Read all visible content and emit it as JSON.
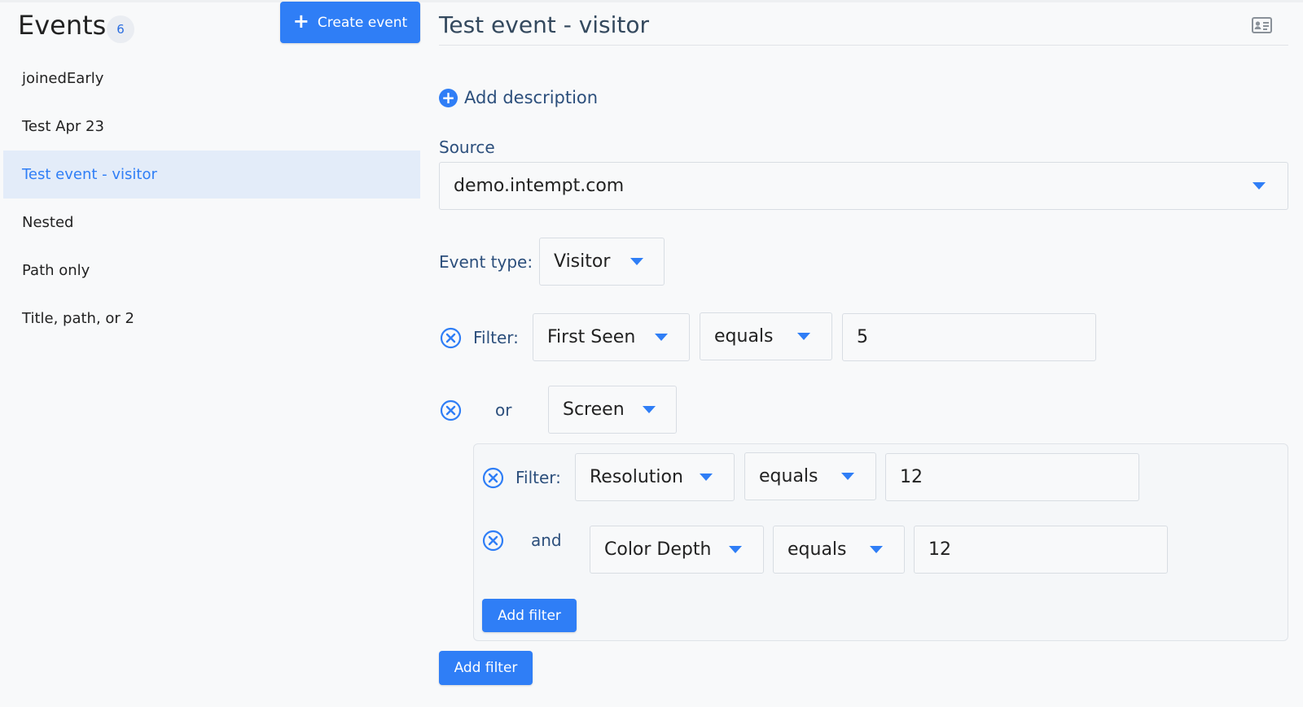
{
  "sidebar": {
    "title": "Events",
    "count": "6",
    "create_label": "Create event",
    "items": [
      {
        "label": "joinedEarly"
      },
      {
        "label": "Test Apr 23"
      },
      {
        "label": "Test event - visitor"
      },
      {
        "label": "Nested"
      },
      {
        "label": "Path only"
      },
      {
        "label": "Title, path, or 2"
      }
    ]
  },
  "main": {
    "title": "Test event - visitor",
    "add_description": "Add description",
    "source_label": "Source",
    "source_value": "demo.intempt.com",
    "event_type_label": "Event type:",
    "event_type_value": "Visitor",
    "filter1": {
      "label": "Filter:",
      "field": "First Seen",
      "op": "equals",
      "value": "5"
    },
    "or_group": {
      "connector": "or",
      "field": "Screen",
      "filter": {
        "label": "Filter:",
        "field": "Resolution",
        "op": "equals",
        "value": "12"
      },
      "and_filter": {
        "connector": "and",
        "field": "Color Depth",
        "op": "equals",
        "value": "12"
      },
      "add_filter_label": "Add filter"
    },
    "add_filter_label": "Add filter"
  },
  "colors": {
    "accent": "#2f7ef6",
    "selected_bg": "#e3ecf9",
    "label": "#2c4f7c"
  }
}
